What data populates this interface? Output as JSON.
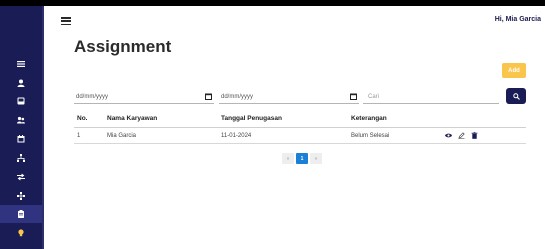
{
  "header": {
    "greeting": "Hi, Mia Garcia"
  },
  "sidebar": {
    "items": [
      {
        "icon": "list-icon"
      },
      {
        "icon": "user-icon"
      },
      {
        "icon": "inbox-icon"
      },
      {
        "icon": "users-icon"
      },
      {
        "icon": "calendar-icon"
      },
      {
        "icon": "hierarchy-icon"
      },
      {
        "icon": "swap-icon"
      },
      {
        "icon": "network-icon"
      },
      {
        "icon": "clipboard-icon",
        "active": true
      },
      {
        "icon": "lightbulb-icon"
      }
    ]
  },
  "page": {
    "title": "Assignment",
    "add_label": "Add"
  },
  "filters": {
    "date_from_placeholder": "dd/mm/yyyy",
    "date_to_placeholder": "dd/mm/yyyy",
    "search_placeholder": "Cari"
  },
  "table": {
    "headers": [
      "No.",
      "Nama Karyawan",
      "Tanggal Penugasan",
      "Keterangan"
    ],
    "rows": [
      {
        "no": "1",
        "nama": "Mia Garcia",
        "tanggal": "11-01-2024",
        "keterangan": "Belum Selesai"
      }
    ]
  },
  "pagination": {
    "prev": "«",
    "current": "1",
    "next": "»"
  },
  "colors": {
    "sidebar": "#1a1d55",
    "accent_yellow": "#f9c54a",
    "page_active": "#1a7fd6"
  }
}
